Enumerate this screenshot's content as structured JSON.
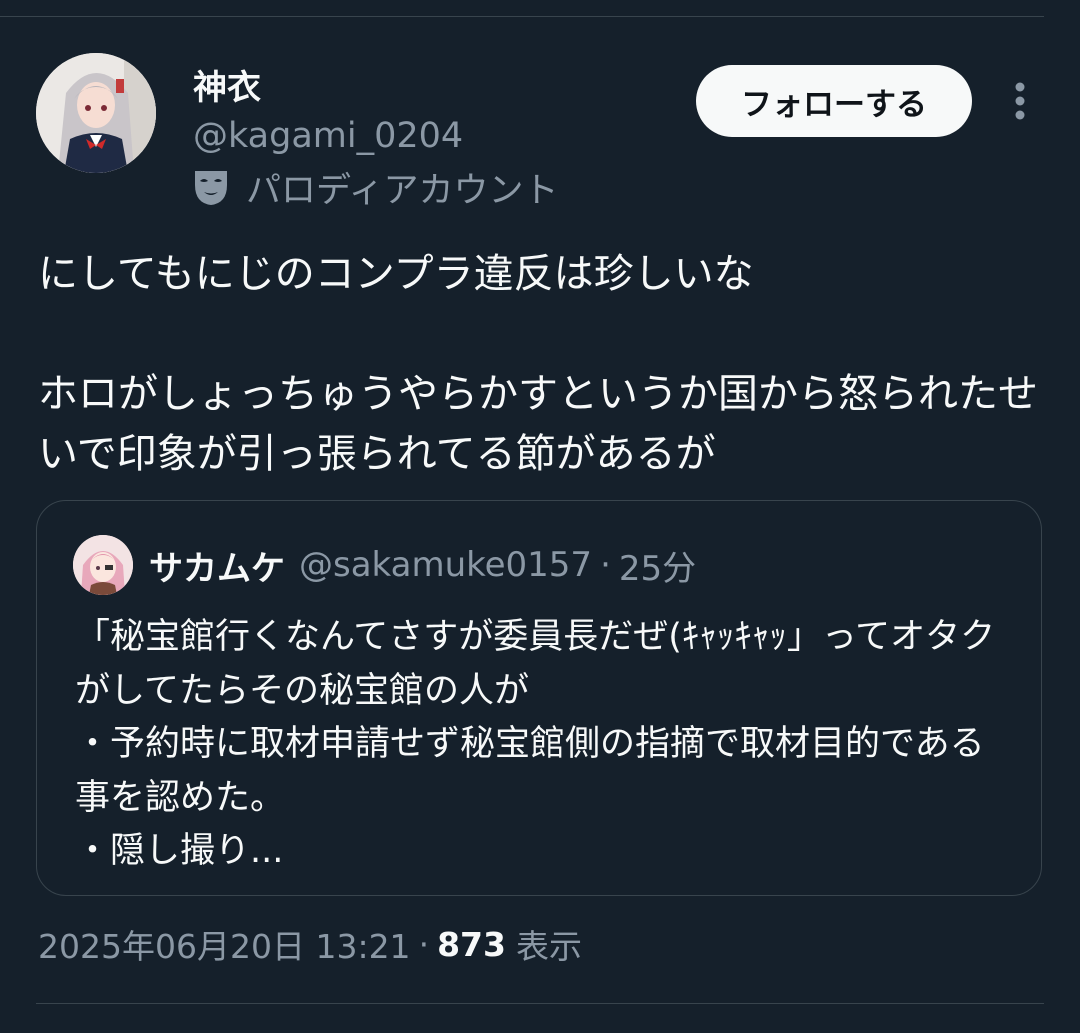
{
  "post": {
    "author": {
      "display_name": "神衣",
      "handle": "@kagami_0204",
      "label_icon": "parody-mask-icon",
      "label": "パロディアカウント"
    },
    "follow_button_label": "フォローする",
    "more_icon": "more-vertical-icon",
    "text": "にしてもにじのコンプラ違反は珍しいな\n\nホロがしょっちゅうやらかすというか国から怒られたせいで印象が引っ張られてる節があるが",
    "quote": {
      "author_name": "サカムケ",
      "author_handle": "@sakamuke0157",
      "separator": "·",
      "time": "25分",
      "text": "「秘宝館行くなんてさすが委員長だぜ(ｷｬｯｷｬｯ」ってオタクがしてたらその秘宝館の人が\n・予約時に取材申請せず秘宝館側の指摘で取材目的である事を認めた。\n・隠し撮り..."
    },
    "timestamp": "2025年06月20日 13:21",
    "separator": "·",
    "views_count": "873",
    "views_label": "表示"
  },
  "colors": {
    "background": "#15202b",
    "primary_text": "#f7f9f9",
    "secondary_text": "#8b98a5",
    "border": "#38444d",
    "button_bg": "#f7f9f9",
    "button_text": "#0f1419"
  }
}
